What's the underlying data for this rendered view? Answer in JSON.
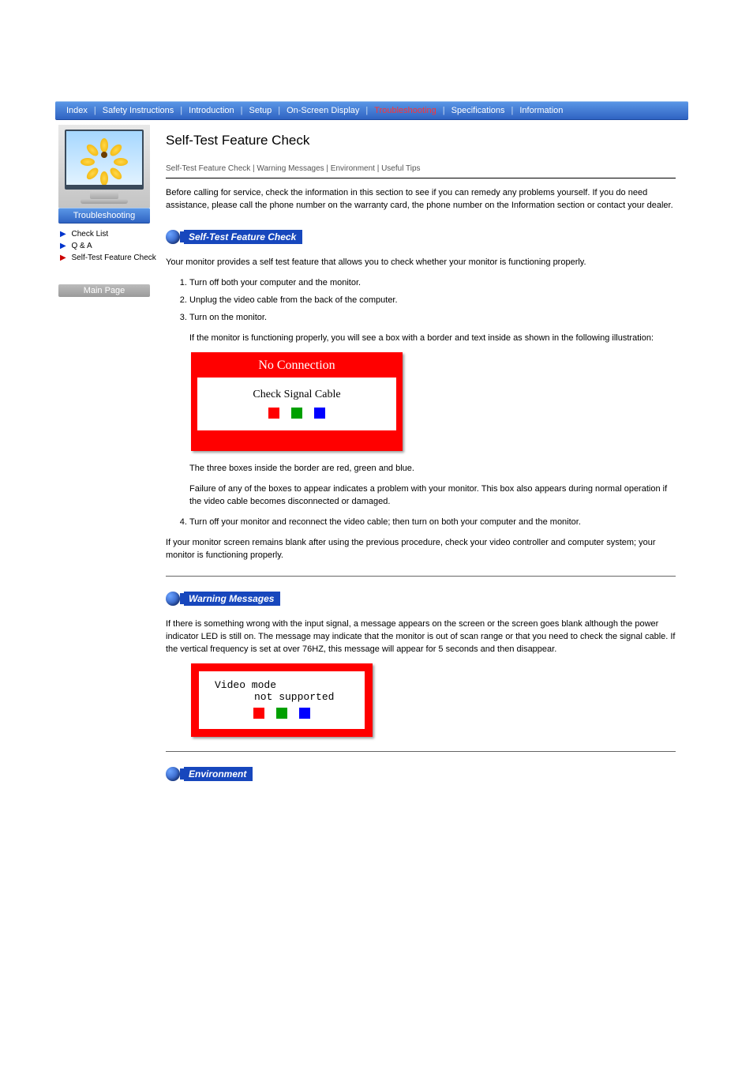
{
  "nav": {
    "items": [
      "Index",
      "Safety Instructions",
      "Introduction",
      "Setup",
      "On-Screen Display",
      "Troubleshooting",
      "Specifications",
      "Information"
    ],
    "active_index": 5
  },
  "sidebar": {
    "section_label": "Troubleshooting",
    "links": [
      {
        "label": "Check List"
      },
      {
        "label": "Q & A"
      },
      {
        "label": "Self-Test Feature Check"
      }
    ],
    "main_page_btn": "Main Page"
  },
  "page": {
    "title": "Self-Test Feature Check",
    "crumbs": "Self-Test Feature Check | Warning Messages | Environment | Useful Tips",
    "intro_note": "Before calling for service, check the information in this section to see if you can remedy any problems yourself. If you do need assistance, please call the phone number on the warranty card, the phone number on the Information section or contact your dealer.",
    "selftest": {
      "pill": "Self-Test Feature Check",
      "p1": "Your monitor provides a self test feature that allows you to check whether your monitor is functioning properly.",
      "steps": [
        "Turn off both your computer and the monitor.",
        "Unplug the video cable from the back of the computer.",
        "Turn on the monitor."
      ],
      "p2": "If the monitor is functioning properly, you will see a box with a border and text inside as shown in the following illustration:",
      "fig_title": "No Connection",
      "fig_msg": "Check Signal Cable",
      "p3": "The three boxes inside the border are red, green and blue.",
      "p4": "Failure of any of the boxes to appear indicates a problem with your monitor. This box also appears during normal operation if the video cable becomes disconnected or damaged.",
      "step4": "Turn off your monitor and reconnect the video cable; then turn on both your computer and the monitor.",
      "p5": "If your monitor screen remains blank after using the previous procedure, check your video controller and computer system; your monitor is functioning properly."
    },
    "warning": {
      "pill": "Warning Messages",
      "p1": "If there is something wrong with the input signal, a message appears on the screen or the screen goes blank although the power indicator LED is still on. The message may indicate that the monitor is out of scan range or that you need to check the signal cable. If the vertical frequency is set at over 76HZ, this message will appear for 5 seconds and then disappear.",
      "fig_line1": "Video mode",
      "fig_line2": "not supported"
    },
    "environment": {
      "pill": "Environment"
    }
  }
}
